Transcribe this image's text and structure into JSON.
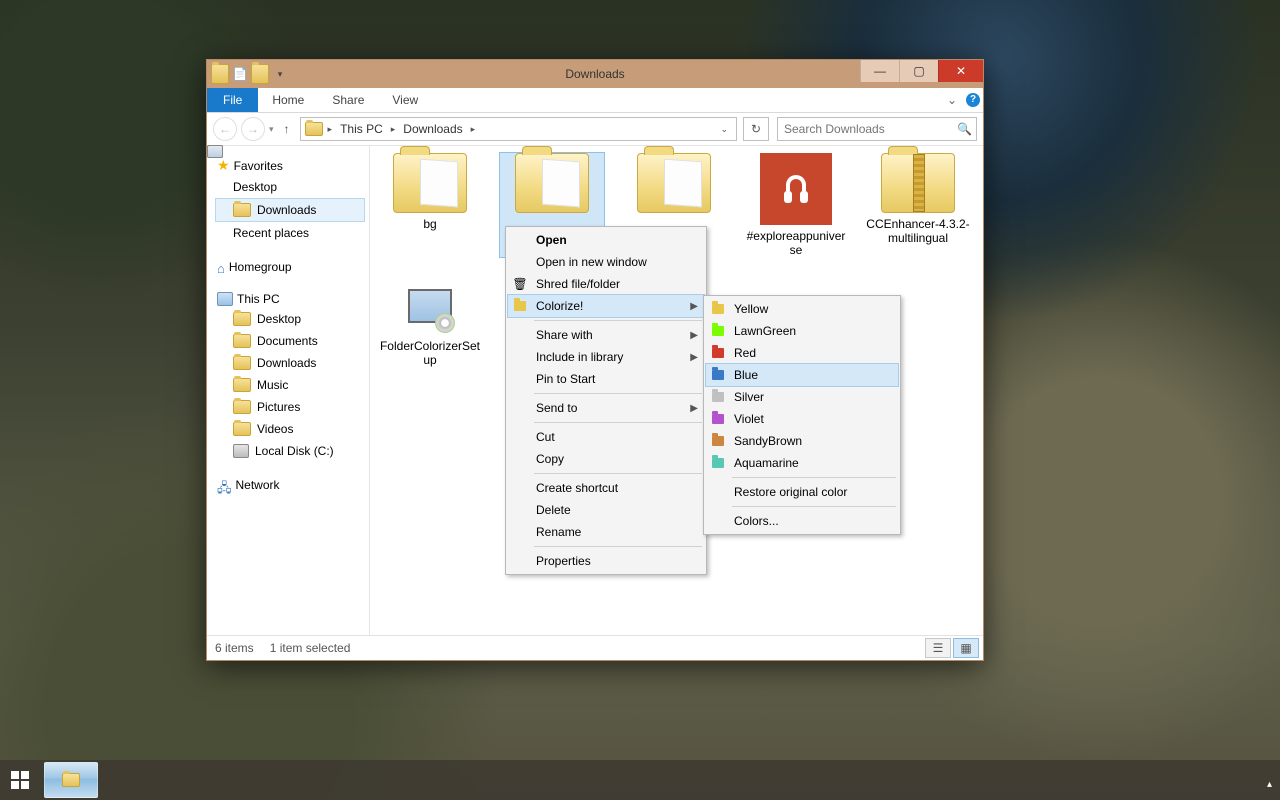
{
  "window": {
    "title": "Downloads"
  },
  "ribbon": {
    "file": "File",
    "tabs": [
      "Home",
      "Share",
      "View"
    ]
  },
  "breadcrumb": {
    "root": "This PC",
    "current": "Downloads"
  },
  "search": {
    "placeholder": "Search Downloads"
  },
  "sidebar": {
    "favorites": {
      "label": "Favorites",
      "items": [
        "Desktop",
        "Downloads",
        "Recent places"
      ],
      "selected": 1
    },
    "homegroup": {
      "label": "Homegroup"
    },
    "thispc": {
      "label": "This PC",
      "items": [
        "Desktop",
        "Documents",
        "Downloads",
        "Music",
        "Pictures",
        "Videos",
        "Local Disk (C:)"
      ]
    },
    "network": {
      "label": "Network"
    }
  },
  "items": [
    {
      "name": "bg",
      "kind": "folder"
    },
    {
      "name": "",
      "kind": "folder",
      "selected": true
    },
    {
      "name": "",
      "kind": "folder"
    },
    {
      "name": "#exploreappuniverse",
      "kind": "app"
    },
    {
      "name": "CCEnhancer-4.3.2-multilingual",
      "kind": "zip"
    },
    {
      "name": "FolderColorizerSetup",
      "kind": "exe"
    }
  ],
  "context_menu": [
    {
      "label": "Open",
      "bold": true
    },
    {
      "label": "Open in new window"
    },
    {
      "label": "Shred file/folder",
      "icon": "shred"
    },
    {
      "label": "Colorize!",
      "icon": "colorize",
      "submenu": true,
      "highlighted": true
    },
    {
      "sep": true
    },
    {
      "label": "Share with",
      "submenu": true
    },
    {
      "label": "Include in library",
      "submenu": true
    },
    {
      "label": "Pin to Start"
    },
    {
      "sep": true
    },
    {
      "label": "Send to",
      "submenu": true
    },
    {
      "sep": true
    },
    {
      "label": "Cut"
    },
    {
      "label": "Copy"
    },
    {
      "sep": true
    },
    {
      "label": "Create shortcut"
    },
    {
      "label": "Delete"
    },
    {
      "label": "Rename"
    },
    {
      "sep": true
    },
    {
      "label": "Properties"
    }
  ],
  "color_submenu": {
    "items": [
      {
        "label": "Yellow",
        "color": "#e8c748"
      },
      {
        "label": "LawnGreen",
        "color": "#7cfc00"
      },
      {
        "label": "Red",
        "color": "#d23b2b"
      },
      {
        "label": "Blue",
        "color": "#3a78c8",
        "highlighted": true
      },
      {
        "label": "Silver",
        "color": "#c0c0c0"
      },
      {
        "label": "Violet",
        "color": "#b452cd"
      },
      {
        "label": "SandyBrown",
        "color": "#cd853f"
      },
      {
        "label": "Aquamarine",
        "color": "#58c8b4"
      }
    ],
    "restore": "Restore original color",
    "more": "Colors..."
  },
  "status": {
    "count": "6 items",
    "selected": "1 item selected"
  }
}
